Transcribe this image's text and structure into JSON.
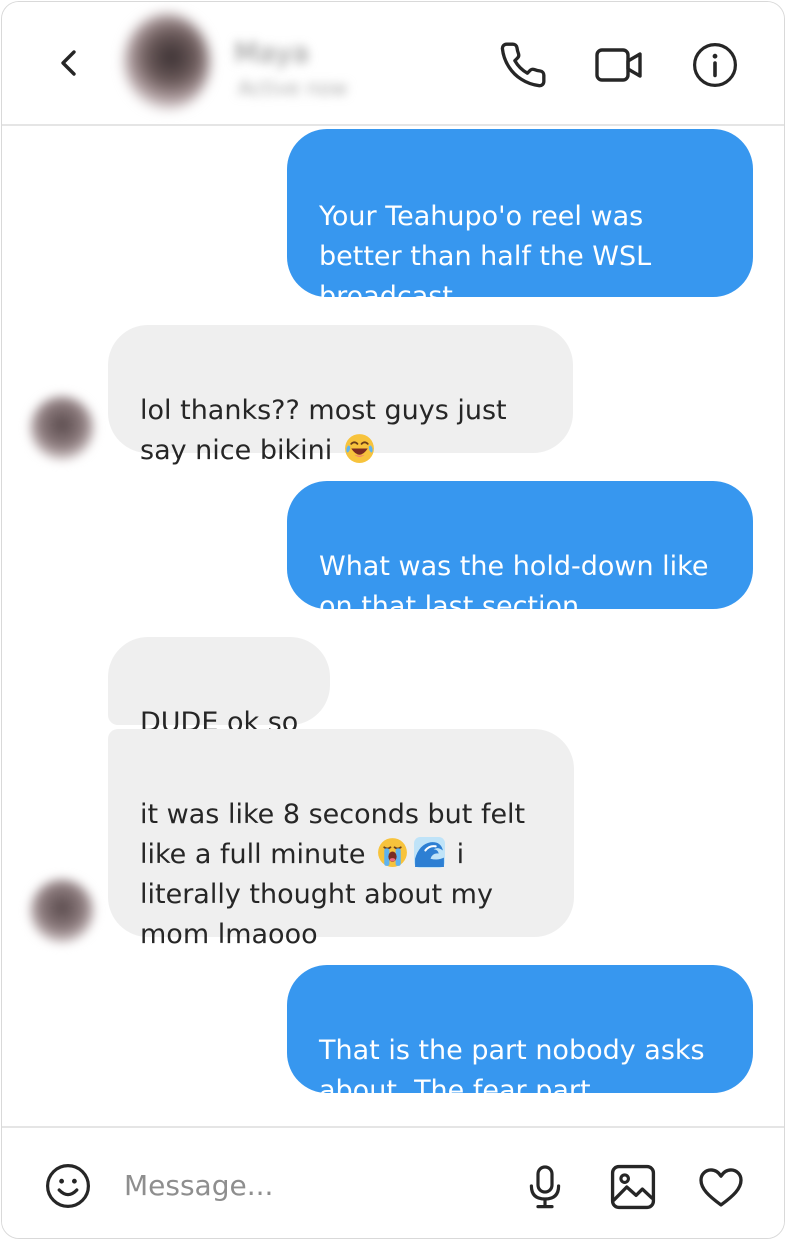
{
  "header": {
    "contact_name": "Maya",
    "contact_status": "Active now",
    "icons": {
      "back": "chevron-left-icon",
      "call": "phone-icon",
      "video": "video-camera-icon",
      "info": "info-icon"
    }
  },
  "messages": [
    {
      "direction": "sent",
      "text": "Your Teahupo'o reel was\nbetter than half the WSL\nbroadcast."
    },
    {
      "direction": "received",
      "text_before_emoji": "lol thanks?? most guys just\nsay nice bikini ",
      "emoji": "face-with-tears-of-joy"
    },
    {
      "direction": "sent",
      "text": "What was the hold-down like\non that last section."
    },
    {
      "direction": "received",
      "text": "DUDE ok so"
    },
    {
      "direction": "received",
      "text_line1": "it was like 8 seconds but felt",
      "text_line2_start": "like a full minute ",
      "emojis": [
        "loudly-crying-face",
        "water-wave"
      ],
      "text_line2_end": " i",
      "text_rest": "literally thought about my\nmom lmaooo"
    },
    {
      "direction": "sent",
      "text": "That is the part nobody asks\nabout. The fear part."
    }
  ],
  "composer": {
    "placeholder": "Message...",
    "value": "",
    "icons": {
      "emoji": "smiley-face-icon",
      "voice": "microphone-icon",
      "photo": "image-icon",
      "like": "heart-icon"
    }
  },
  "colors": {
    "sent_bubble": "#3797ef",
    "received_bubble": "#efefef",
    "divider": "#e5e5e5",
    "icon": "#262626",
    "placeholder": "#8e8e8e"
  }
}
